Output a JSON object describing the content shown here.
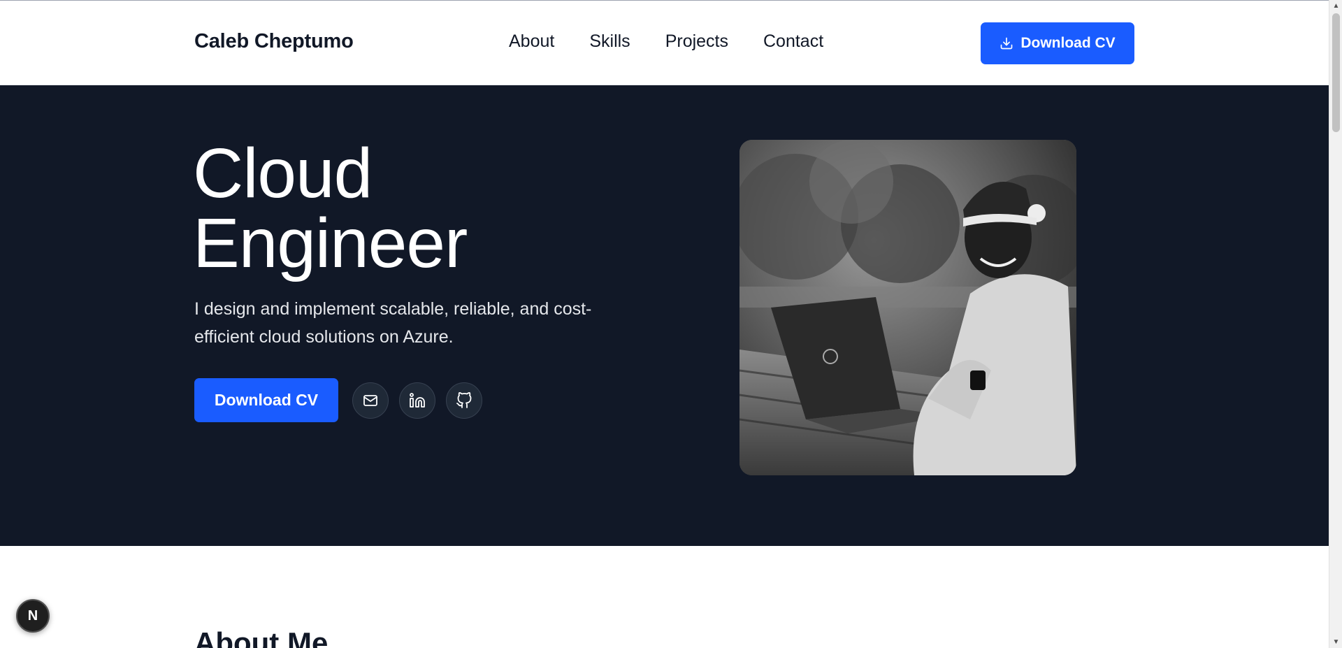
{
  "header": {
    "brand": "Caleb Cheptumo",
    "nav": [
      "About",
      "Skills",
      "Projects",
      "Contact"
    ],
    "cta_label": "Download CV"
  },
  "hero": {
    "title_line1": "Cloud",
    "title_line2": "Engineer",
    "subtitle": "I design and implement scalable, reliable, and cost-efficient cloud solutions on Azure.",
    "cta_label": "Download CV",
    "socials": [
      "mail-icon",
      "linkedin-icon",
      "github-icon"
    ],
    "photo_alt": "Caleb Cheptumo working on a laptop"
  },
  "about": {
    "heading": "About Me"
  },
  "dev_badge": {
    "label": "N"
  },
  "colors": {
    "accent": "#1a5cff",
    "hero_bg": "#111827",
    "text_dark": "#111827"
  }
}
